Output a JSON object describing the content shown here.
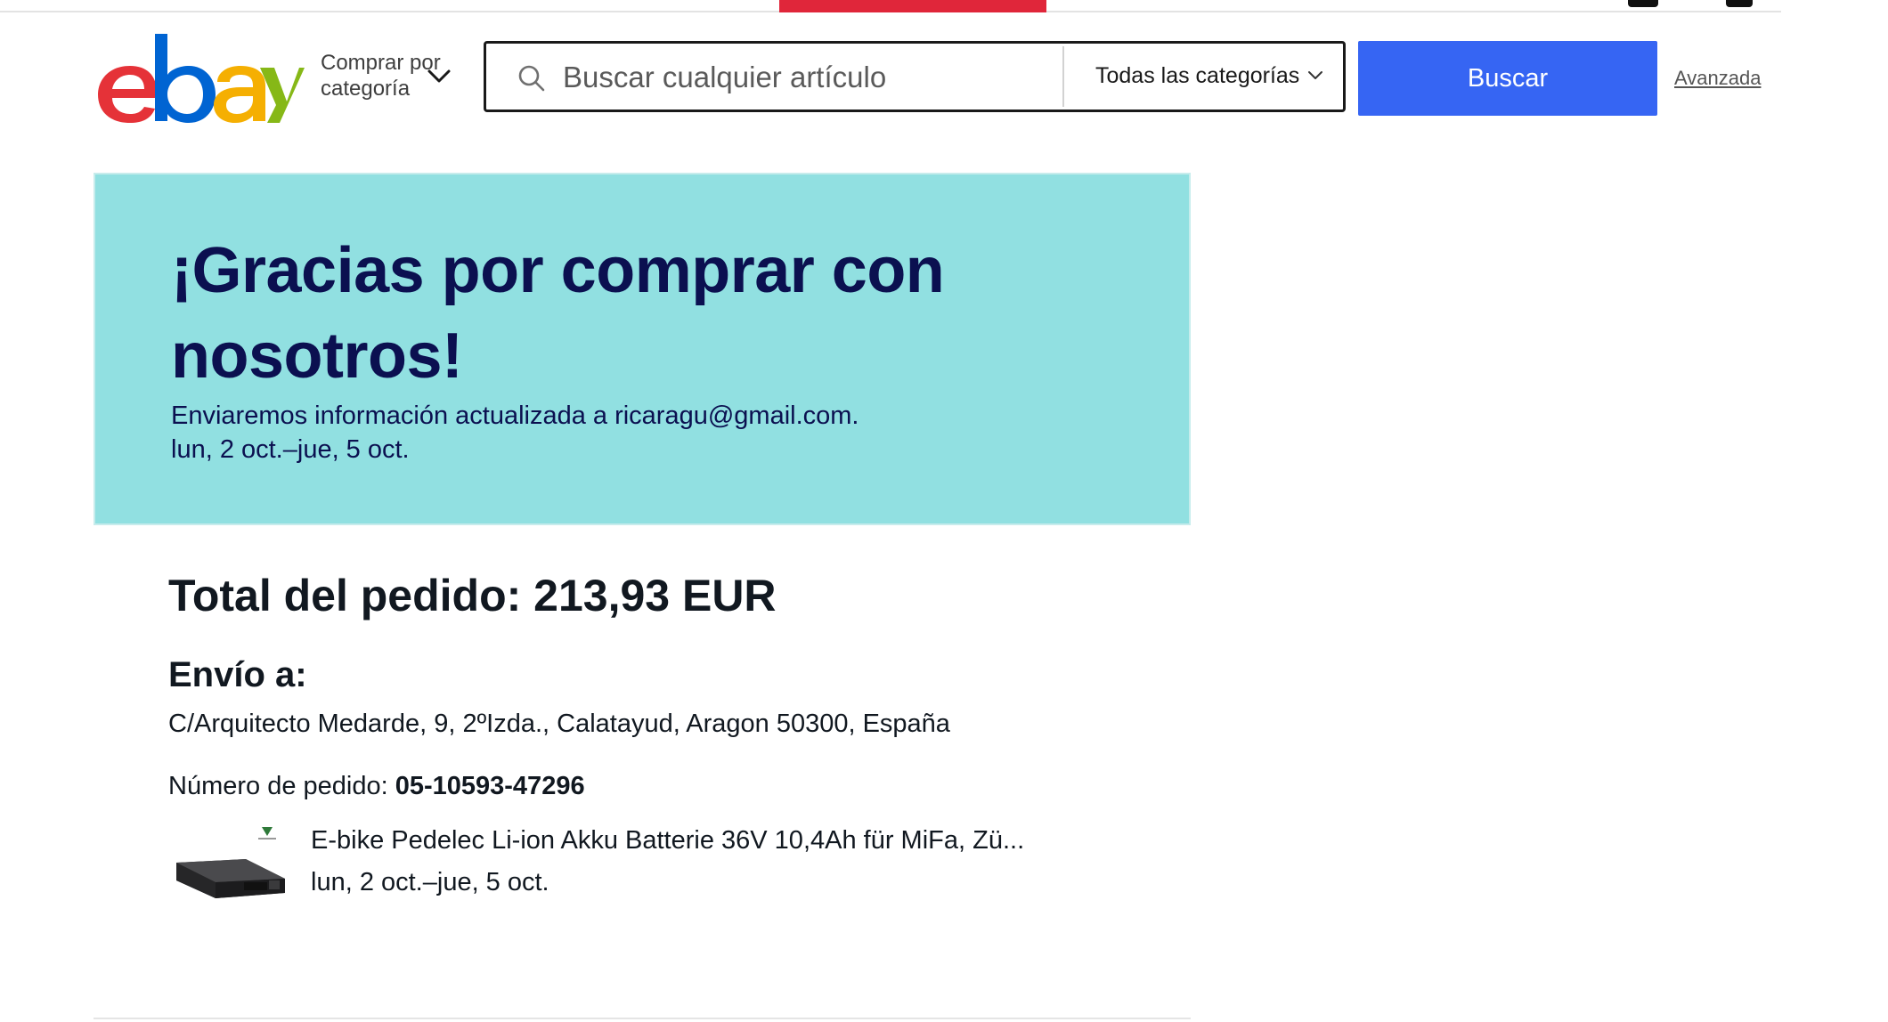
{
  "header": {
    "shop_by_line1": "Comprar por",
    "shop_by_line2": "categoría",
    "search_placeholder": "Buscar cualquier artículo",
    "category_selected": "Todas las categorías",
    "search_button": "Buscar",
    "advanced_link": "Avanzada"
  },
  "banner": {
    "title": "¡Gracias por comprar con nosotros!",
    "email_note": "Enviaremos información actualizada a ricaragu@gmail.com.",
    "delivery_range": "lun, 2 oct.–jue, 5 oct."
  },
  "order": {
    "total": "Total del pedido: 213,93 EUR",
    "ship_to_heading": "Envío a:",
    "address": "C/Arquitecto Medarde, 9, 2ºIzda., Calatayud, Aragon 50300, España",
    "order_number_label": "Número de pedido: ",
    "order_number": "05-10593-47296",
    "item": {
      "title": "E-bike Pedelec Li-ion Akku Batterie 36V 10,4Ah für MiFa, Zü...",
      "delivery": "lun, 2 oct.–jue, 5 oct."
    }
  },
  "colors": {
    "banner_bg": "#91e0e1",
    "banner_text": "#0b1050",
    "search_button": "#3665f3",
    "logo_e": "#e53238",
    "logo_b": "#0064d2",
    "logo_a": "#f5af02",
    "logo_y": "#86b817"
  }
}
